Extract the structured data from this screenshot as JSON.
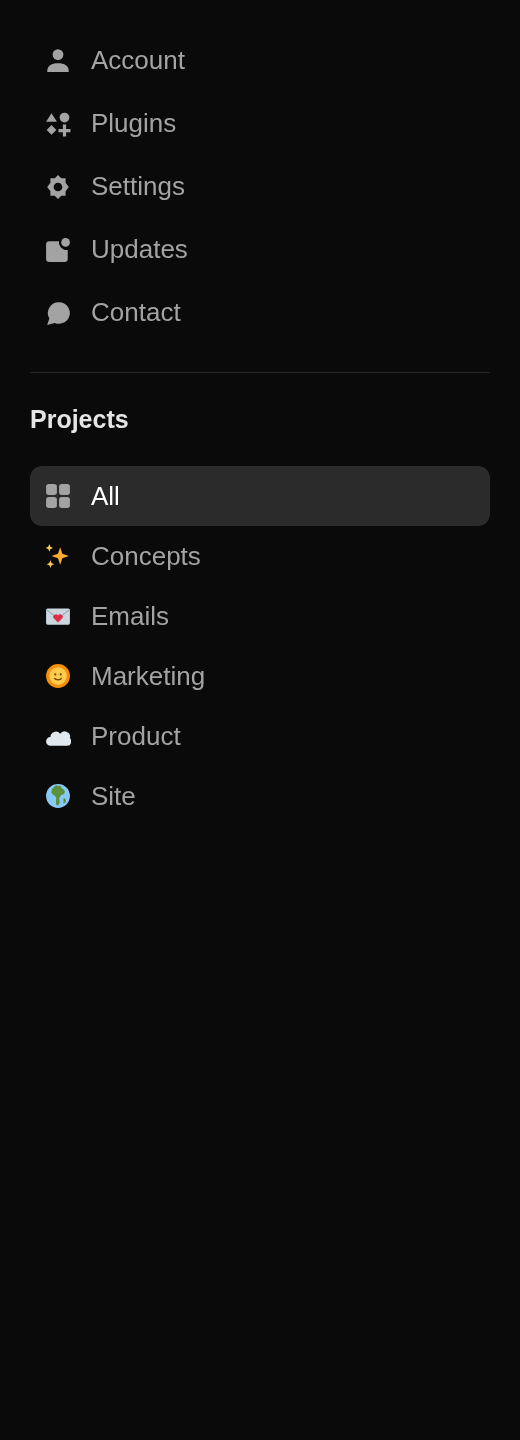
{
  "nav": [
    {
      "label": "Account",
      "kind": "person"
    },
    {
      "label": "Plugins",
      "kind": "shapes"
    },
    {
      "label": "Settings",
      "kind": "gear"
    },
    {
      "label": "Updates",
      "kind": "badge"
    },
    {
      "label": "Contact",
      "kind": "chat"
    }
  ],
  "projects": {
    "title": "Projects",
    "items": [
      {
        "label": "All",
        "kind": "grid",
        "selected": true
      },
      {
        "label": "Concepts",
        "kind": "sparkles",
        "selected": false
      },
      {
        "label": "Emails",
        "kind": "envelope",
        "selected": false
      },
      {
        "label": "Marketing",
        "kind": "sun",
        "selected": false
      },
      {
        "label": "Product",
        "kind": "cloud",
        "selected": false
      },
      {
        "label": "Site",
        "kind": "globe",
        "selected": false
      }
    ]
  }
}
